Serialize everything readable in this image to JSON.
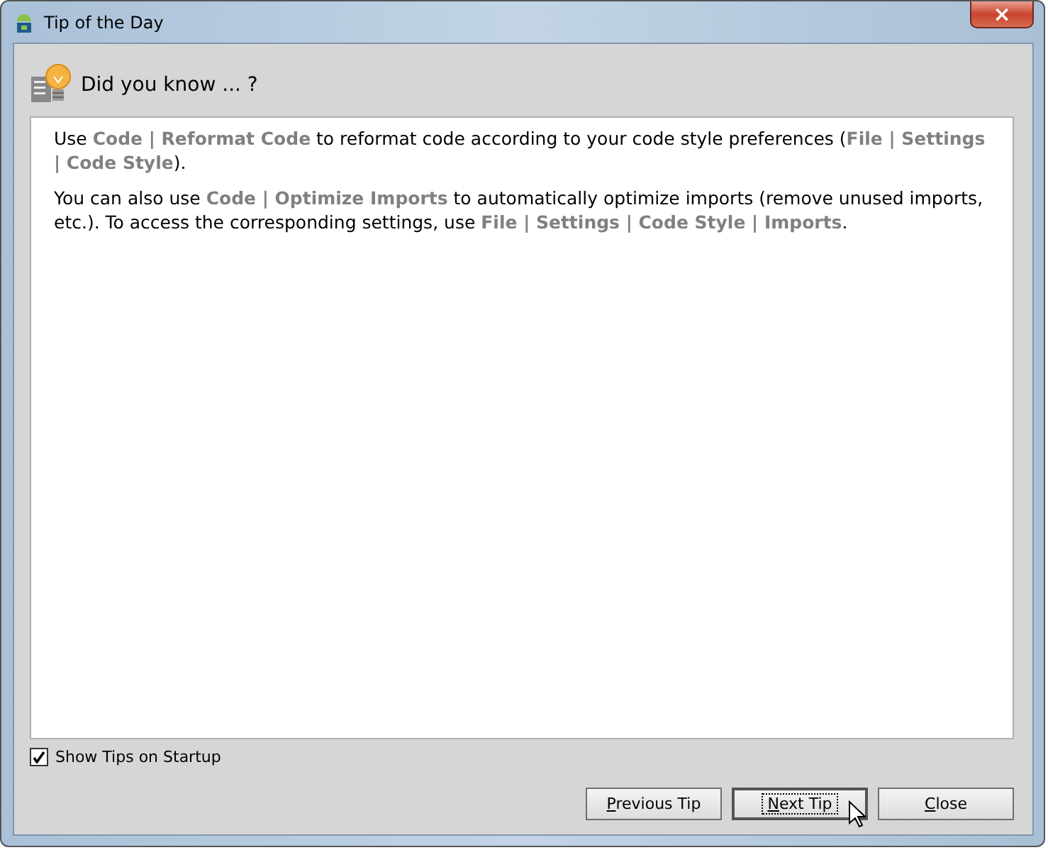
{
  "window": {
    "title": "Tip of the Day",
    "close": "×"
  },
  "heading": "Did you know ... ?",
  "paragraphs": [
    "Use **Code | Reformat Code** to reformat code according to your code style preferences (**File | Settings | Code Style**).",
    "You can also use **Code | Optimize Imports** to automatically optimize imports (remove unused imports, etc.). To access the corresponding settings, use **File | Settings | Code Style | Imports**."
  ],
  "show_tips": {
    "label": "Show Tips on Startup",
    "checked": true
  },
  "buttons": [
    {
      "label": "Previous Tip",
      "focused": false
    },
    {
      "label": "Next Tip",
      "focused": true
    },
    {
      "label": "Close",
      "focused": false
    }
  ]
}
